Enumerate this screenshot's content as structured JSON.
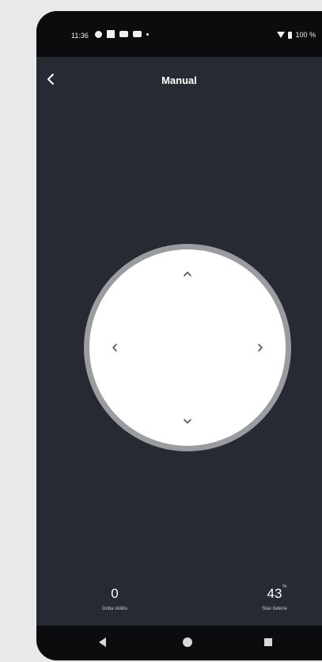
{
  "status_bar": {
    "time": "11:36",
    "icons": [
      "app-notification-icon",
      "square-notification-icon",
      "mail-icon",
      "youtube-icon",
      "dot-icon"
    ],
    "battery_text": "100 %"
  },
  "header": {
    "title": "Manual",
    "back_icon": "chevron-left-icon"
  },
  "joystick": {
    "up_icon": "chevron-up-icon",
    "down_icon": "chevron-down-icon",
    "left_icon": "chevron-left-icon",
    "right_icon": "chevron-right-icon"
  },
  "stats": {
    "left": {
      "value": "0",
      "unit": "",
      "label": "Doba úklidu"
    },
    "right": {
      "value": "43",
      "unit": "%",
      "label": "Stav baterie"
    }
  },
  "nav_bar": {
    "back_icon": "triangle-back-icon",
    "home_icon": "circle-home-icon",
    "recents_icon": "square-recents-icon"
  },
  "colors": {
    "app_background": "#262a33",
    "system_bar": "#0b0c0e",
    "joystick_fill": "#ffffff",
    "joystick_ring": "#9a9ca0",
    "page_background": "#e9e9e9"
  }
}
